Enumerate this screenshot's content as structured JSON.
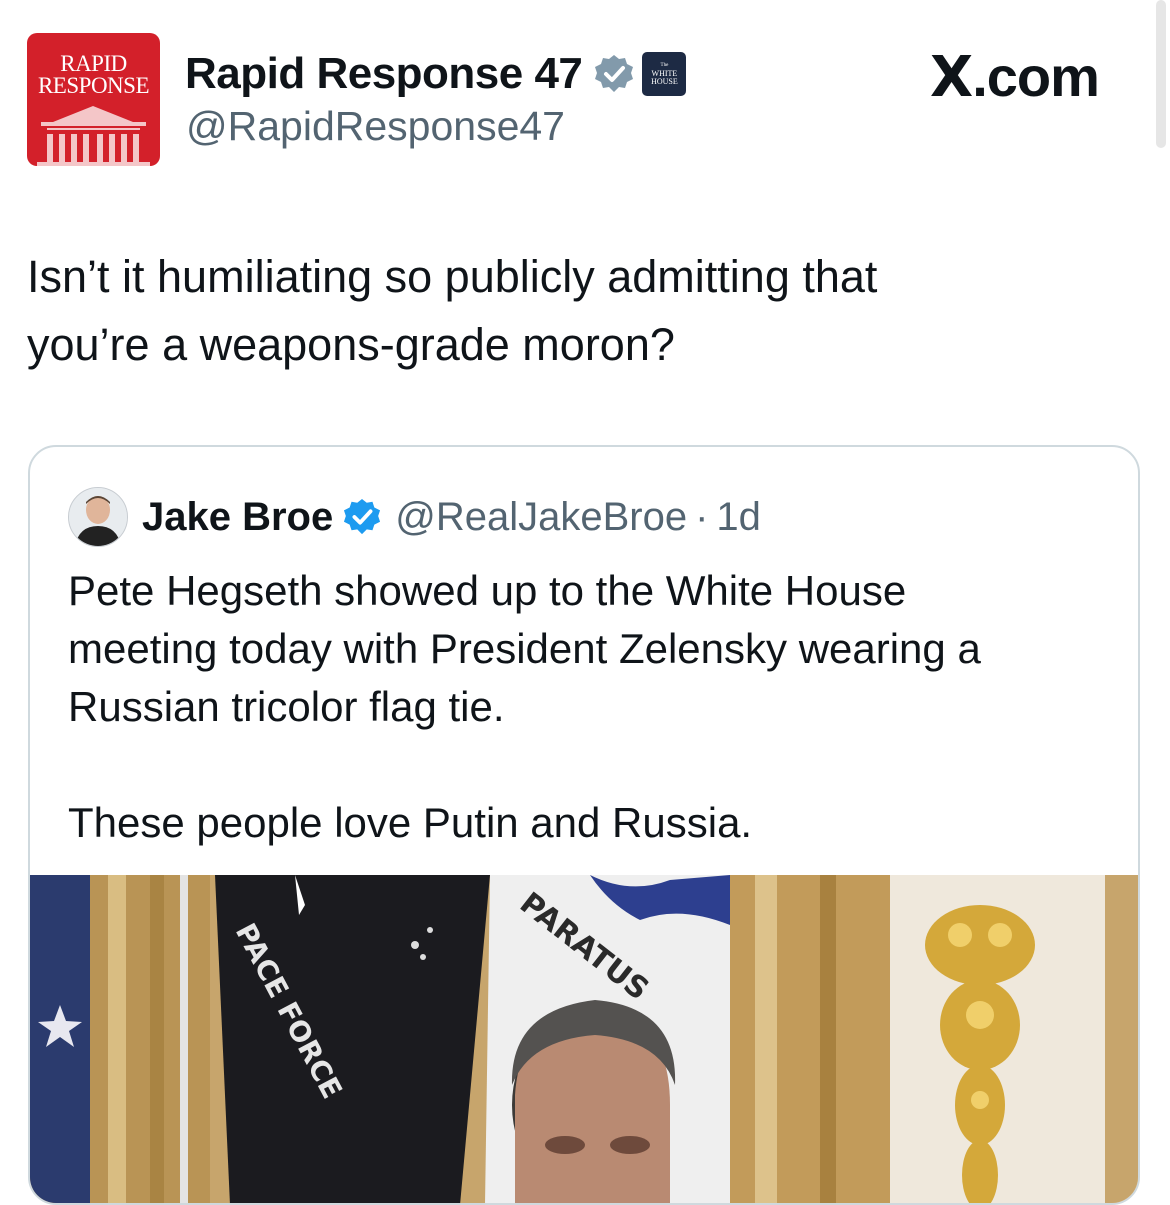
{
  "header": {
    "avatar_line1": "RAPID",
    "avatar_line2": "RESPONSE",
    "display_name": "Rapid Response 47",
    "handle": "@RapidResponse47",
    "verified_icon": "gray-verified-badge-icon",
    "affiliation_badge_line1": "The",
    "affiliation_badge_line2": "WHITE",
    "affiliation_badge_line3": "HOUSE",
    "brand_x": "X",
    "brand_suffix": ".com"
  },
  "tweet": {
    "text_line1": "Isn’t it humiliating so publicly admitting that",
    "text_line2": "you’re a weapons-grade moron?"
  },
  "quoted_tweet": {
    "display_name": "Jake Broe",
    "verified_icon": "blue-verified-badge-icon",
    "handle": "@RealJakeBroe",
    "separator": "·",
    "time": "1d",
    "paragraph1_line1": "Pete Hegseth showed up to the White House",
    "paragraph1_line2": "meeting today with President Zelensky wearing a",
    "paragraph1_line3": "Russian tricolor flag tie.",
    "paragraph2": "These people love Putin and Russia.",
    "photo": {
      "flag_text_left": "PACE FORCE",
      "flag_text_right": "PARATUS"
    }
  },
  "colors": {
    "text_primary": "#0f1419",
    "text_secondary": "#536471",
    "border": "#cfd9de",
    "verified_blue": "#1d9bf0",
    "verified_gray": "#829aab",
    "avatar_red": "#d3202a"
  }
}
